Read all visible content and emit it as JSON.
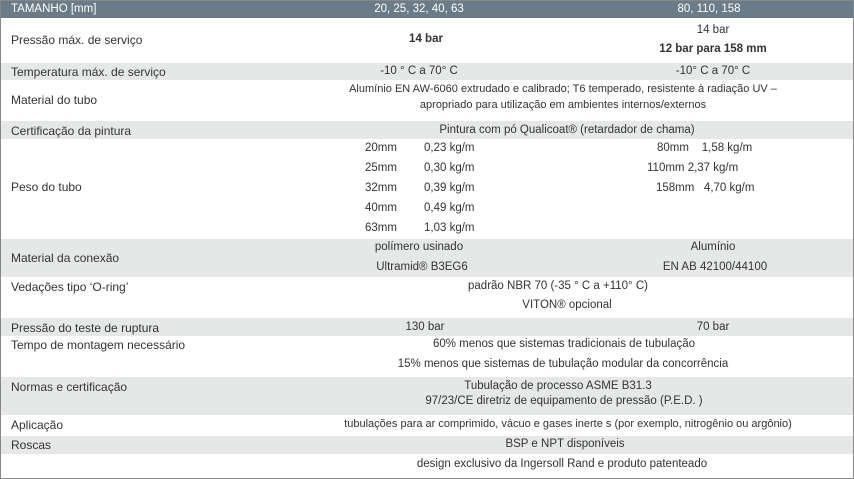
{
  "header": {
    "label": "TAMANHO [mm]",
    "col1": "20, 25, 32, 40, 63",
    "col2": "80, 110, 158"
  },
  "pressao": {
    "label": "Pressão máx. de serviço",
    "col1": "14 bar",
    "col2_line1": "14 bar",
    "col2_line2": "12 bar para 158 mm"
  },
  "temperatura": {
    "label": "Temperatura máx. de serviço",
    "col1": "-10 ° C a 70° C",
    "col2": "-10° C a 70° C"
  },
  "material_tubo": {
    "label": "Material do tubo",
    "line1": "Alumínio EN AW-6060 extrudado e calibrado; T6 temperado, resistente à radiação UV –",
    "line2": "apropriado para utilização em ambientes internos/externos"
  },
  "certificacao": {
    "label": "Certificação da pintura",
    "value": "Pintura com pó Qualicoat® (retardador de chama)"
  },
  "peso": {
    "label": "Peso do tubo",
    "col1": [
      {
        "size": "20mm",
        "weight": "0,23 kg/m"
      },
      {
        "size": "25mm",
        "weight": "0,30 kg/m"
      },
      {
        "size": "32mm",
        "weight": "0,39 kg/m"
      },
      {
        "size": "40mm",
        "weight": "0,49 kg/m"
      },
      {
        "size": "63mm",
        "weight": "1,03 kg/m"
      }
    ],
    "col2": [
      "80mm    1,58 kg/m",
      "110mm 2,37 kg/m",
      "158mm   4,70 kg/m"
    ]
  },
  "conexao": {
    "label": "Material da conexão",
    "col1_line1": "polímero usinado",
    "col1_line2": "Ultramid® B3EG6",
    "col2_line1": "Alumínio",
    "col2_line2": "EN AB 42100/44100"
  },
  "vedacoes": {
    "label": "Vedações tipo ‘O-ring’",
    "line1": "padrão NBR 70 (-35 ° C a +110° C)",
    "line2": "VITON® opcional"
  },
  "ruptura": {
    "label": "Pressão do teste de ruptura",
    "col1": "130 bar",
    "col2": "70 bar"
  },
  "montagem": {
    "label": "Tempo de montagem necessário",
    "line1": "60% menos que sistemas tradicionais de tubulação",
    "line2": "15% menos que sistemas de tubulação modular da concorrência"
  },
  "normas": {
    "label": "Normas e certificação",
    "line1": "Tubulação de processo ASME B31.3",
    "line2": "97/23/CE diretriz de equipamento de pressão (P.E.D. )"
  },
  "aplicacao": {
    "label": "Aplicação",
    "value": "tubulações para ar comprimido, vácuo e gases inerte s (por exemplo, nitrogênio ou argônio)"
  },
  "roscas": {
    "label": "Roscas",
    "line1": "BSP e NPT disponíveis",
    "line2": "design exclusivo da Ingersoll Rand e produto patenteado"
  }
}
